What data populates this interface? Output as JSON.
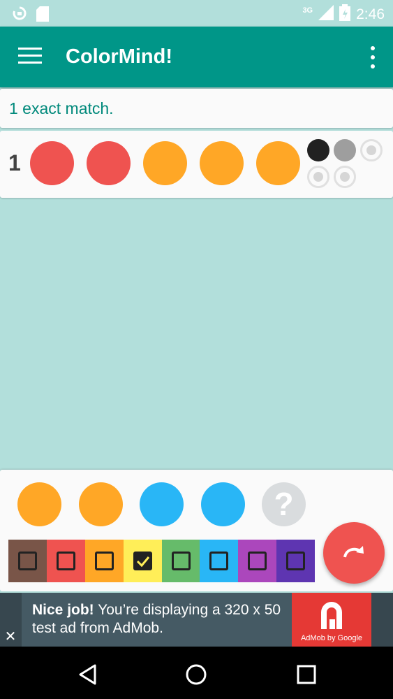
{
  "status_bar": {
    "time": "2:46",
    "network": "3G",
    "icons": [
      "sync-icon",
      "sd-card-icon",
      "signal-icon",
      "battery-icon"
    ]
  },
  "app_bar": {
    "title": "ColorMind!",
    "menu_icon": "hamburger-menu-icon",
    "more_icon": "more-vert-icon",
    "color": "#009688"
  },
  "message": {
    "text": "1 exact match."
  },
  "guesses": [
    {
      "number": "1",
      "pegs": [
        "#ef5350",
        "#ef5350",
        "#ffa726",
        "#ffa726",
        "#ffa726"
      ],
      "feedback": [
        "exact",
        "partial",
        "none",
        "none",
        "none"
      ]
    }
  ],
  "feedback_colors": {
    "exact": "#212121",
    "partial": "#9e9e9e"
  },
  "current_guess": {
    "pegs": [
      "#ffa726",
      "#ffa726",
      "#29b6f6",
      "#29b6f6",
      "unknown"
    ],
    "unknown_symbol": "?"
  },
  "palette": {
    "colors": [
      "#795548",
      "#ef5350",
      "#ffa726",
      "#ffee58",
      "#66bb6a",
      "#29b6f6",
      "#ab47bc",
      "#5e35b1"
    ],
    "checked_index": 3
  },
  "fab": {
    "icon": "redo-icon",
    "color": "#ef5350"
  },
  "ad": {
    "headline": "Nice job!",
    "body": " You’re displaying a 320 x 50 test ad from AdMob.",
    "logo_caption": "AdMob by Google",
    "close_symbol": "✕"
  },
  "nav_bar": {
    "icons": [
      "back-icon",
      "home-icon",
      "recents-icon"
    ]
  }
}
